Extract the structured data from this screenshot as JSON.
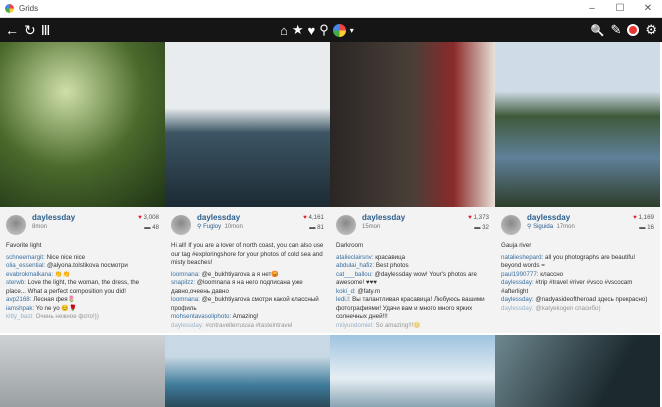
{
  "window": {
    "title": "Grids",
    "minimize": "–",
    "maximize": "☐",
    "close": "✕"
  },
  "toolbar": {
    "back": "←",
    "refresh": "↻",
    "menu": "Ⅲ",
    "home": "⌂",
    "star": "★",
    "heart": "♥",
    "pin": "⚲",
    "dropdown": "▾",
    "search": "🔍",
    "tag": "✎",
    "settings": "⚙"
  },
  "posts": [
    {
      "user": "daylessday",
      "location": "",
      "time": "8mon",
      "likes": "3,008",
      "comments": "48",
      "caption": "Favorite light",
      "comment_list": [
        {
          "u": "schneemargit:",
          "t": " Nice nice nice"
        },
        {
          "u": "olia_essential:",
          "t": " @alyona.tolstikova посмотри"
        },
        {
          "u": "evabrokmalkana:",
          "t": " 👏👏"
        },
        {
          "u": "sterwb:",
          "t": " Love the light, the woman, the dress, the place... What a perfect composition you did!"
        },
        {
          "u": "avp2168:",
          "t": " Лесная фея🌷"
        },
        {
          "u": "iamshpak:",
          "t": " Yo ne yo 😊🌹"
        },
        {
          "u": "kitty_bast:",
          "t": " Очень нежное фото!))"
        }
      ]
    },
    {
      "user": "daylessday",
      "location": "Fugloy",
      "time": "10mon",
      "likes": "4,161",
      "comments": "81",
      "caption": "Hi all! If you are a lover of north coast, you can also use our tag #exploringshore for your photos of cold sea and misty beaches!",
      "comment_list": [
        {
          "u": "loomnana:",
          "t": " @e_bukhtiyarova а я нет😡"
        },
        {
          "u": "snapilzz:",
          "t": " @loomnana я на него подписана уже давно,очеень давно"
        },
        {
          "u": "loomnana:",
          "t": " @e_bukhtiyarova смотри какой классный профиль"
        },
        {
          "u": "mohsentavasoliphoto:",
          "t": " Amazing!"
        },
        {
          "u": "daylessday:",
          "t": " #cntravellerrussia #tasteintravel"
        }
      ]
    },
    {
      "user": "daylessday",
      "location": "",
      "time": "15mon",
      "likes": "1,373",
      "comments": "32",
      "caption": "Darkroom",
      "comment_list": [
        {
          "u": "atalieclairsnv:",
          "t": " красавица"
        },
        {
          "u": "abdulai_hafiz:",
          "t": " Best photos"
        },
        {
          "u": "cat___ballou:",
          "t": " @daylessday wow! Your's photos are awesome! ♥♥♥"
        },
        {
          "u": "koki_d:",
          "t": " @faty.m"
        },
        {
          "u": "ledi.l:",
          "t": " Вы талантливая красавица! Любуюсь вашими фотографиями! Удачи вам и много много ярких солнечных дней!!!"
        },
        {
          "u": "milyundomiel:",
          "t": " So amazing!!!😊"
        }
      ]
    },
    {
      "user": "daylessday",
      "location": "Siguida",
      "time": "17mon",
      "likes": "1,169",
      "comments": "16",
      "caption": "Gauja river",
      "comment_list": [
        {
          "u": "natalieshepard:",
          "t": " all you photographs are beautiful beyond words ="
        },
        {
          "u": "paul1990777:",
          "t": " классно"
        },
        {
          "u": "daylessday:",
          "t": " #trip #travel #river #vsco #vscocam #afterlight"
        },
        {
          "u": "daylessday:",
          "t": " @nadyasideoftheroad здесь прекрасно)"
        },
        {
          "u": "daylessday:",
          "t": " @katyekogen спасибо)"
        }
      ]
    }
  ]
}
